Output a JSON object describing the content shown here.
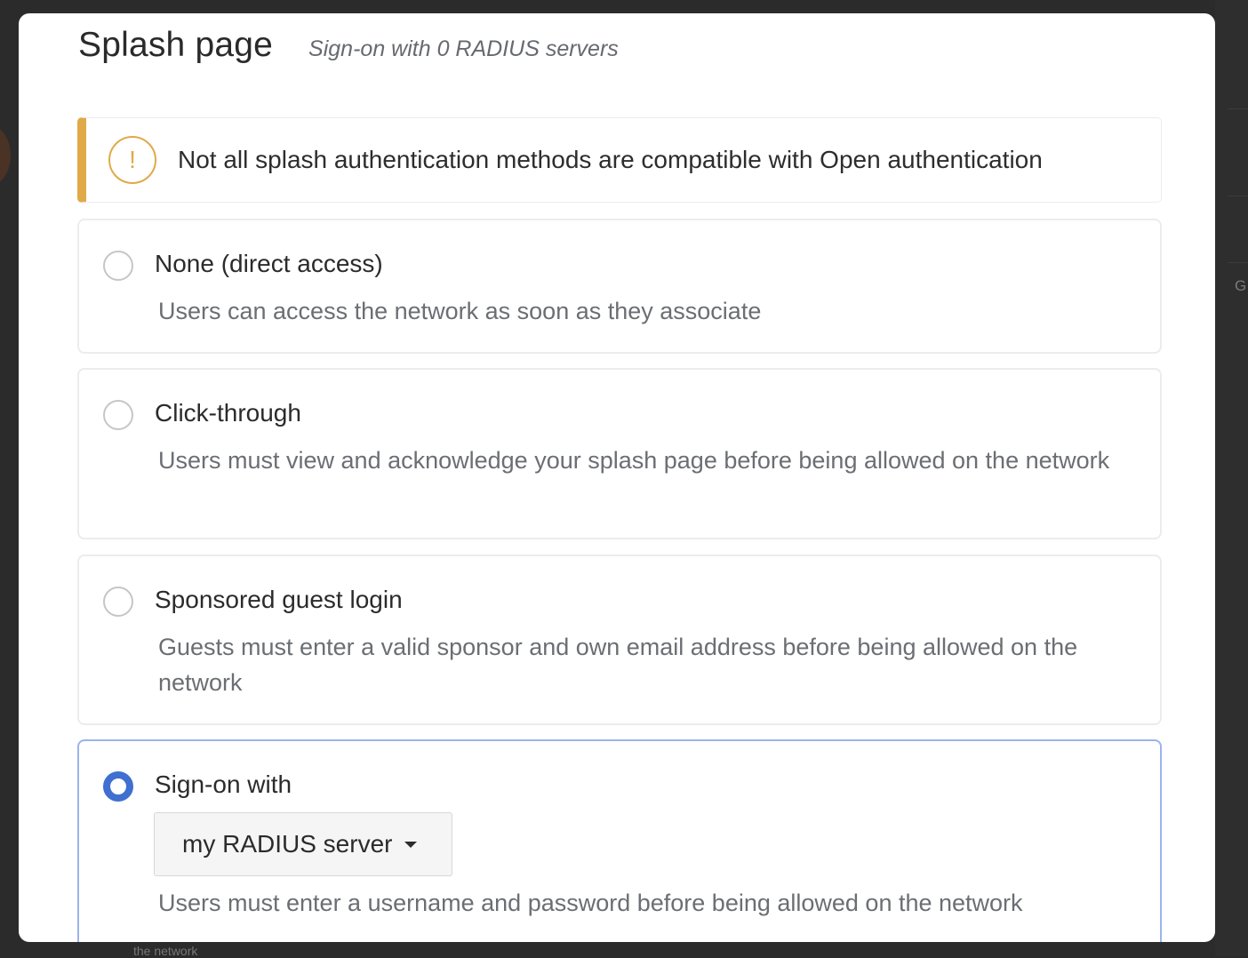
{
  "background": {
    "edge_letter": "G",
    "footer_fragment": "the network"
  },
  "header": {
    "title": "Splash page",
    "subtitle": "Sign-on with 0 RADIUS servers"
  },
  "warning": {
    "icon": "exclamation-circle-icon",
    "icon_glyph": "!",
    "text": "Not all splash authentication methods are compatible with Open authentication",
    "accent_color": "#e0aa48"
  },
  "options": [
    {
      "title": "None (direct access)",
      "description": "Users can access the network as soon as they associate",
      "selected": false
    },
    {
      "title": "Click-through",
      "description": "Users must view and acknowledge your splash page before being allowed on the network",
      "selected": false
    },
    {
      "title": "Sponsored guest login",
      "description": "Guests must enter a valid sponsor and own email address before being allowed on the network",
      "selected": false
    },
    {
      "title": "Sign-on with",
      "dropdown_value": "my RADIUS server",
      "description": "Users must enter a username and password before being allowed on the network",
      "selected": true
    }
  ],
  "colors": {
    "selected_radio": "#3f6fd0",
    "selected_border": "#9bb4ec"
  }
}
